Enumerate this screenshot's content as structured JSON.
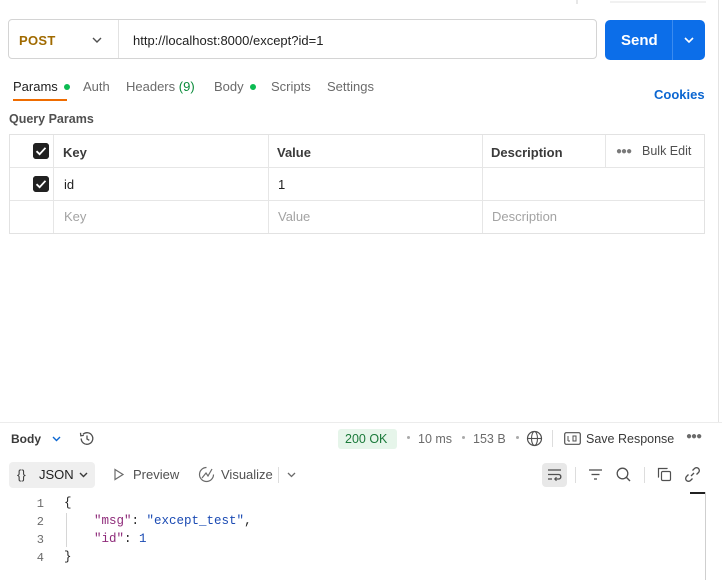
{
  "request": {
    "method": "POST",
    "url": "http://localhost:8000/except?id=1",
    "send_label": "Send"
  },
  "tabs": [
    {
      "label": "Params",
      "active": true,
      "dot": true
    },
    {
      "label": "Auth"
    },
    {
      "label": "Headers",
      "count": "(9)"
    },
    {
      "label": "Body",
      "dot": true
    },
    {
      "label": "Scripts"
    },
    {
      "label": "Settings"
    }
  ],
  "cookies_label": "Cookies",
  "query_params": {
    "title": "Query Params",
    "columns": {
      "key": "Key",
      "value": "Value",
      "description": "Description"
    },
    "bulk_edit": "Bulk Edit",
    "rows": [
      {
        "checked": true,
        "key": "id",
        "value": "1",
        "description": ""
      }
    ],
    "placeholders": {
      "key": "Key",
      "value": "Value",
      "description": "Description"
    }
  },
  "response": {
    "body_label": "Body",
    "status": "200 OK",
    "time": "10 ms",
    "size": "153 B",
    "save_label": "Save Response",
    "format": {
      "braces": "{}",
      "label": "JSON"
    },
    "preview_label": "Preview",
    "visualize_label": "Visualize",
    "lines": [
      "1",
      "2",
      "3",
      "4"
    ],
    "json": {
      "open": "{",
      "msg_key": "\"msg\"",
      "msg_value": "\"except_test\"",
      "id_key": "\"id\"",
      "id_value": "1",
      "close": "}"
    }
  },
  "colors": {
    "accent": "#0c6ee9",
    "tab_underline": "#ef6c00",
    "method": "#a06a00",
    "status_ok": "#1b7a3a"
  }
}
